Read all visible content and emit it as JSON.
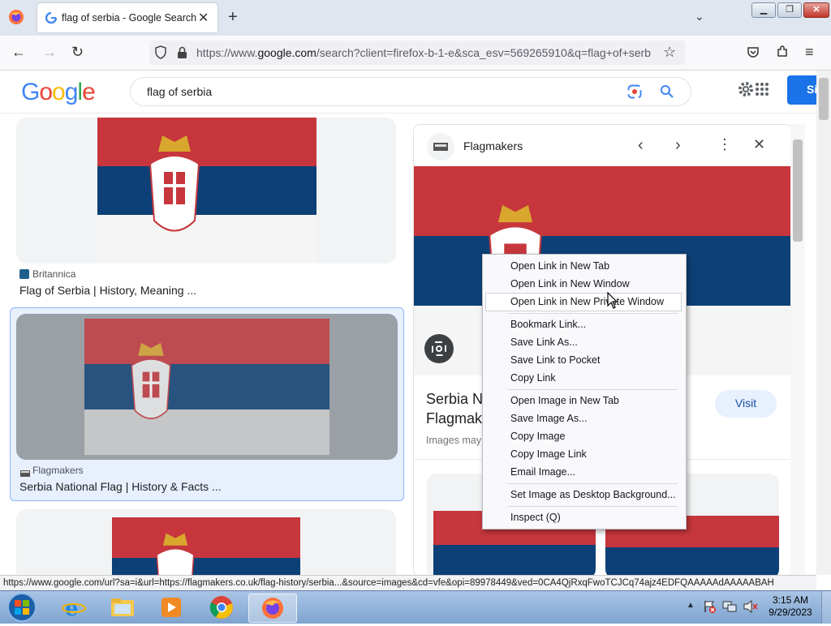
{
  "browser": {
    "tab_title": "flag of serbia - Google Search",
    "url_prefix": "https://www.",
    "url_domain": "google.com",
    "url_rest": "/search?client=firefox-b-1-e&sca_esv=569265910&q=flag+of+serb"
  },
  "google": {
    "logo": "Google",
    "query": "flag of serbia",
    "signin_label": "Si"
  },
  "results": [
    {
      "source": "Britannica",
      "title": "Flag of Serbia | History, Meaning ..."
    },
    {
      "source": "Flagmakers",
      "title": "Serbia National Flag | History & Facts ..."
    }
  ],
  "panel": {
    "source": "Flagmakers",
    "title_line1": "Serbia N",
    "title_line2": "Flagmak",
    "subtitle": "Images may",
    "visit_label": "Visit"
  },
  "context_menu": {
    "items": [
      "Open Link in New Tab",
      "Open Link in New Window",
      "Open Link in New Private Window",
      "Bookmark Link...",
      "Save Link As...",
      "Save Link to Pocket",
      "Copy Link",
      "Open Image in New Tab",
      "Save Image As...",
      "Copy Image",
      "Copy Image Link",
      "Email Image...",
      "Set Image as Desktop Background...",
      "Inspect (Q)"
    ]
  },
  "status_bar": "https://www.google.com/url?sa=i&url=https://flagmakers.co.uk/flag-history/serbia...&source=images&cd=vfe&opi=89978449&ved=0CA4QjRxqFwoTCJCq74ajz4EDFQAAAAAdAAAAABAH",
  "clock": {
    "time": "3:15 AM",
    "date": "9/29/2023"
  },
  "colors": {
    "flag_red": "#c6363c",
    "flag_blue": "#0c4076",
    "flag_white": "#f5f5f5",
    "google_blue": "#1a73e8"
  },
  "icons": [
    "firefox-icon",
    "google-g-icon",
    "back-icon",
    "forward-icon",
    "reload-icon",
    "shield-icon",
    "lock-icon",
    "star-icon",
    "pocket-icon",
    "extensions-icon",
    "menu-icon",
    "lens-icon",
    "search-icon",
    "settings-icon",
    "apps-icon",
    "chevron-left-icon",
    "chevron-right-icon",
    "more-vert-icon",
    "close-icon",
    "lens-search-icon"
  ]
}
